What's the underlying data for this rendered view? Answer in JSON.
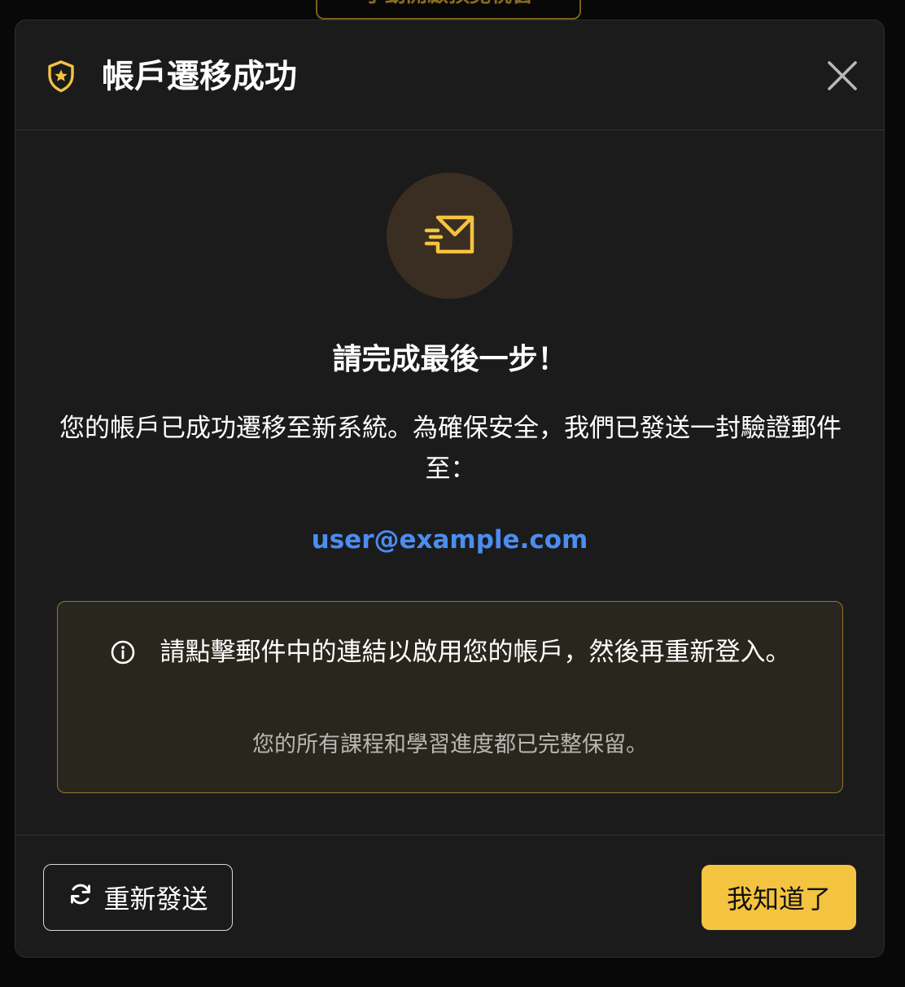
{
  "background": {
    "partial_button_label": "手動開啟預覽視窗"
  },
  "modal": {
    "title": "帳戶遷移成功",
    "header_icon": "shield-star-icon",
    "close_icon": "close-icon",
    "mail_icon": "mail-send-icon",
    "heading": "請完成最後一步！",
    "description": "您的帳戶已成功遷移至新系統。為確保安全，我們已發送一封驗證郵件至：",
    "email": "user@example.com",
    "info": {
      "icon": "info-icon",
      "main": "請點擊郵件中的連結以啟用您的帳戶，然後再重新登入。",
      "sub": "您的所有課程和學習進度都已完整保留。"
    },
    "footer": {
      "resend_label": "重新發送",
      "resend_icon": "refresh-icon",
      "ok_label": "我知道了"
    }
  },
  "colors": {
    "accent": "#f4c440",
    "link": "#4b8df0",
    "modal_bg": "#1b1b1c",
    "info_bg": "#29271d",
    "info_border": "#98752a"
  }
}
